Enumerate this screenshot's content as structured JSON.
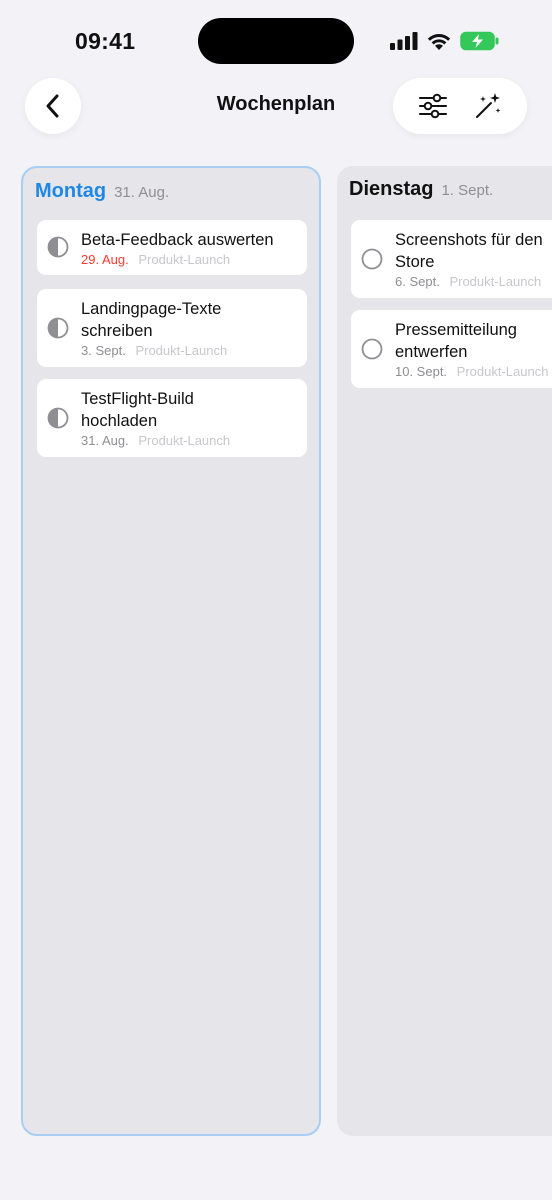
{
  "status_bar": {
    "time": "09:41"
  },
  "nav": {
    "back_icon": "chevron-left-icon",
    "title": "Wochenplan",
    "actions": [
      {
        "icon": "sliders-icon"
      },
      {
        "icon": "magic-wand-icon"
      }
    ]
  },
  "colors": {
    "accent": "#1e88e5",
    "overdue": "#ff3b30",
    "column_bg": "#e5e5ea",
    "selected_border": "#a8cff3"
  },
  "columns": [
    {
      "day": "Montag",
      "date": "31. Aug.",
      "selected": true,
      "tasks": [
        {
          "title": "Beta-Feedback auswerten",
          "due": "29. Aug.",
          "overdue": true,
          "project": "Produkt-Launch",
          "status": "in-progress"
        },
        {
          "title_lines": [
            "Landingpage-Texte",
            "schreiben"
          ],
          "due": "3. Sept.",
          "project": "Produkt-Launch",
          "status": "in-progress"
        },
        {
          "title_lines": [
            "TestFlight-Build",
            "hochladen"
          ],
          "due": "31. Aug.",
          "project": "Produkt-Launch",
          "status": "in-progress"
        }
      ]
    },
    {
      "day": "Dienstag",
      "date": "1. Sept.",
      "selected": false,
      "tasks": [
        {
          "title_lines": [
            "Screenshots für den",
            "Store"
          ],
          "due": "6. Sept.",
          "project": "Produkt-Launch",
          "status": "open"
        },
        {
          "title_lines": [
            "Pressemitteilung",
            "entwerfen"
          ],
          "due": "10. Sept.",
          "project": "Produkt-Launch",
          "status": "open"
        }
      ]
    }
  ]
}
